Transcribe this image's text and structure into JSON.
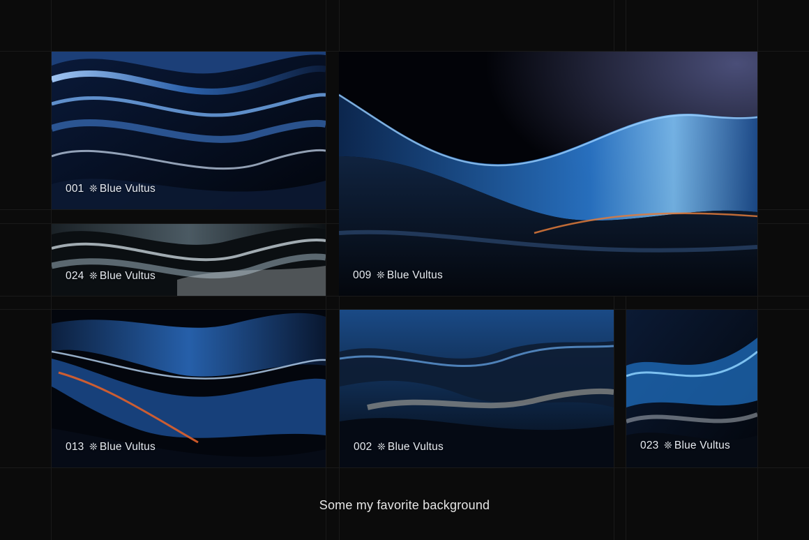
{
  "gallery": {
    "tiles": [
      {
        "number": "001",
        "separator": "❊",
        "name": "Blue Vultus"
      },
      {
        "number": "024",
        "separator": "❊",
        "name": "Blue Vultus"
      },
      {
        "number": "009",
        "separator": "❊",
        "name": "Blue Vultus"
      },
      {
        "number": "013",
        "separator": "❊",
        "name": "Blue Vultus"
      },
      {
        "number": "002",
        "separator": "❊",
        "name": "Blue Vultus"
      },
      {
        "number": "023",
        "separator": "❊",
        "name": "Blue Vultus"
      }
    ],
    "caption": "Some my favorite background"
  },
  "colors": {
    "background": "#0b0b0b",
    "accent_blue": "#3b8fe0",
    "deep_navy": "#0a1530",
    "highlight_orange": "#e0602a"
  }
}
